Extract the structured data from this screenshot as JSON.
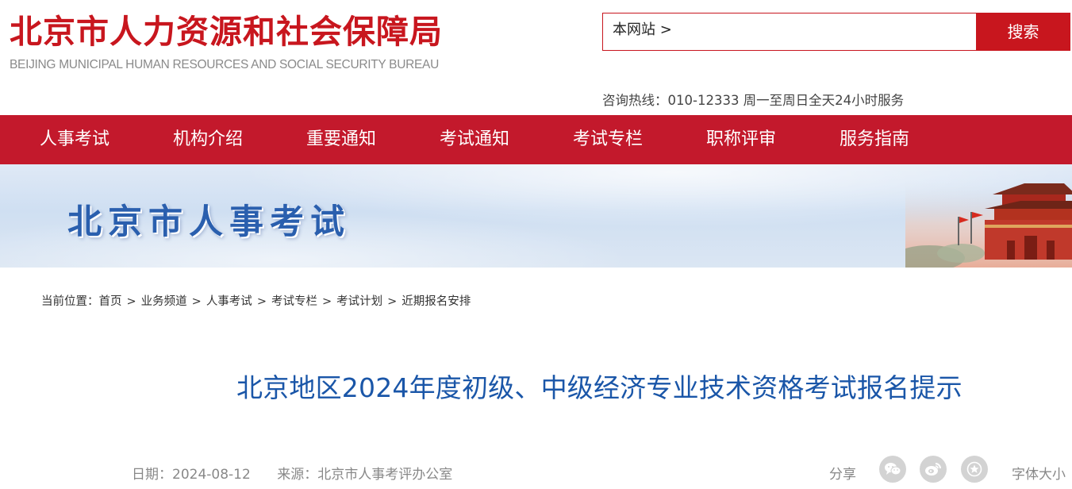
{
  "header": {
    "logo_cn": "北京市人力资源和社会保障局",
    "logo_en": "BEIJING MUNICIPAL HUMAN RESOURCES AND SOCIAL SECURITY BUREAU",
    "search_scope": "本网站 >",
    "search_button": "搜索",
    "hotline": "咨询热线：010-12333 周一至周日全天24小时服务"
  },
  "nav": {
    "items": [
      {
        "label": "人事考试"
      },
      {
        "label": "机构介绍"
      },
      {
        "label": "重要通知"
      },
      {
        "label": "考试通知"
      },
      {
        "label": "考试专栏"
      },
      {
        "label": "职称评审"
      },
      {
        "label": "服务指南"
      }
    ]
  },
  "banner": {
    "title": "北京市人事考试"
  },
  "breadcrumb": {
    "prefix": "当前位置：",
    "items": [
      "首页",
      "业务频道",
      "人事考试",
      "考试专栏",
      "考试计划",
      "近期报名安排"
    ],
    "separator": ">"
  },
  "article": {
    "title": "北京地区2024年度初级、中级经济专业技术资格考试报名提示",
    "date": "日期：2024-08-12",
    "source": "来源：北京市人事考评办公室",
    "share_label": "分享",
    "font_size_label": "字体大小"
  },
  "colors": {
    "brand_red": "#c8161e",
    "nav_red": "#c3192c",
    "title_blue": "#1a56a8",
    "banner_title_blue": "#2a5fae"
  },
  "icons": {
    "share": [
      "wechat-icon",
      "weibo-icon",
      "favorite-star-icon"
    ]
  }
}
